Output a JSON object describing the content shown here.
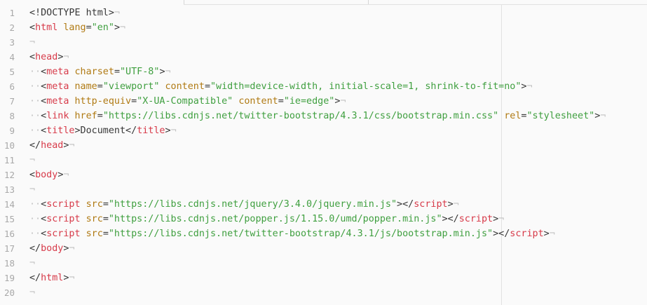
{
  "lines": [
    {
      "n": "1",
      "t": [
        [
          "p",
          "<!DOCTYPE html>"
        ]
      ]
    },
    {
      "n": "2",
      "t": [
        [
          "p",
          "<"
        ],
        [
          "tag",
          "html"
        ],
        [
          "p",
          " "
        ],
        [
          "attr",
          "lang"
        ],
        [
          "p",
          "="
        ],
        [
          "str",
          "\"en\""
        ],
        [
          "p",
          ">"
        ]
      ]
    },
    {
      "n": "3",
      "t": []
    },
    {
      "n": "4",
      "t": [
        [
          "p",
          "<"
        ],
        [
          "tag",
          "head"
        ],
        [
          "p",
          ">"
        ]
      ]
    },
    {
      "n": "5",
      "t": [
        [
          "ws",
          "··"
        ],
        [
          "p",
          "<"
        ],
        [
          "tag",
          "meta"
        ],
        [
          "p",
          " "
        ],
        [
          "attr",
          "charset"
        ],
        [
          "p",
          "="
        ],
        [
          "str",
          "\"UTF-8\""
        ],
        [
          "p",
          ">"
        ]
      ]
    },
    {
      "n": "6",
      "t": [
        [
          "ws",
          "··"
        ],
        [
          "p",
          "<"
        ],
        [
          "tag",
          "meta"
        ],
        [
          "p",
          " "
        ],
        [
          "attr",
          "name"
        ],
        [
          "p",
          "="
        ],
        [
          "str",
          "\"viewport\""
        ],
        [
          "p",
          " "
        ],
        [
          "attr",
          "content"
        ],
        [
          "p",
          "="
        ],
        [
          "str",
          "\"width=device-width, initial-scale=1, shrink-to-fit=no\""
        ],
        [
          "p",
          ">"
        ]
      ]
    },
    {
      "n": "7",
      "t": [
        [
          "ws",
          "··"
        ],
        [
          "p",
          "<"
        ],
        [
          "tag",
          "meta"
        ],
        [
          "p",
          " "
        ],
        [
          "attr",
          "http-equiv"
        ],
        [
          "p",
          "="
        ],
        [
          "str",
          "\"X-UA-Compatible\""
        ],
        [
          "p",
          " "
        ],
        [
          "attr",
          "content"
        ],
        [
          "p",
          "="
        ],
        [
          "str",
          "\"ie=edge\""
        ],
        [
          "p",
          ">"
        ]
      ]
    },
    {
      "n": "8",
      "t": [
        [
          "ws",
          "··"
        ],
        [
          "p",
          "<"
        ],
        [
          "tag",
          "link"
        ],
        [
          "p",
          " "
        ],
        [
          "attr",
          "href"
        ],
        [
          "p",
          "="
        ],
        [
          "str",
          "\"https://libs.cdnjs.net/twitter-bootstrap/4.3.1/css/bootstrap.min.css\""
        ],
        [
          "p",
          " "
        ],
        [
          "attr",
          "rel"
        ],
        [
          "p",
          "="
        ],
        [
          "str",
          "\"stylesheet\""
        ],
        [
          "p",
          ">"
        ]
      ]
    },
    {
      "n": "9",
      "t": [
        [
          "ws",
          "··"
        ],
        [
          "p",
          "<"
        ],
        [
          "tag",
          "title"
        ],
        [
          "p",
          ">Document</"
        ],
        [
          "tag",
          "title"
        ],
        [
          "p",
          ">"
        ]
      ]
    },
    {
      "n": "10",
      "t": [
        [
          "p",
          "</"
        ],
        [
          "tag",
          "head"
        ],
        [
          "p",
          ">"
        ]
      ]
    },
    {
      "n": "11",
      "t": []
    },
    {
      "n": "12",
      "t": [
        [
          "p",
          "<"
        ],
        [
          "tag",
          "body"
        ],
        [
          "p",
          ">"
        ]
      ]
    },
    {
      "n": "13",
      "t": []
    },
    {
      "n": "14",
      "t": [
        [
          "ws",
          "··"
        ],
        [
          "p",
          "<"
        ],
        [
          "tag",
          "script"
        ],
        [
          "p",
          " "
        ],
        [
          "attr",
          "src"
        ],
        [
          "p",
          "="
        ],
        [
          "str",
          "\"https://libs.cdnjs.net/jquery/3.4.0/jquery.min.js\""
        ],
        [
          "p",
          "></"
        ],
        [
          "tag",
          "script"
        ],
        [
          "p",
          ">"
        ]
      ]
    },
    {
      "n": "15",
      "t": [
        [
          "ws",
          "··"
        ],
        [
          "p",
          "<"
        ],
        [
          "tag",
          "script"
        ],
        [
          "p",
          " "
        ],
        [
          "attr",
          "src"
        ],
        [
          "p",
          "="
        ],
        [
          "str",
          "\"https://libs.cdnjs.net/popper.js/1.15.0/umd/popper.min.js\""
        ],
        [
          "p",
          "></"
        ],
        [
          "tag",
          "script"
        ],
        [
          "p",
          ">"
        ]
      ]
    },
    {
      "n": "16",
      "t": [
        [
          "ws",
          "··"
        ],
        [
          "p",
          "<"
        ],
        [
          "tag",
          "script"
        ],
        [
          "p",
          " "
        ],
        [
          "attr",
          "src"
        ],
        [
          "p",
          "="
        ],
        [
          "str",
          "\"https://libs.cdnjs.net/twitter-bootstrap/4.3.1/js/bootstrap.min.js\""
        ],
        [
          "p",
          "></"
        ],
        [
          "tag",
          "script"
        ],
        [
          "p",
          ">"
        ]
      ]
    },
    {
      "n": "17",
      "t": [
        [
          "p",
          "</"
        ],
        [
          "tag",
          "body"
        ],
        [
          "p",
          ">"
        ]
      ]
    },
    {
      "n": "18",
      "t": []
    },
    {
      "n": "19",
      "t": [
        [
          "p",
          "</"
        ],
        [
          "tag",
          "html"
        ],
        [
          "p",
          ">"
        ]
      ]
    },
    {
      "n": "20",
      "t": []
    }
  ],
  "eol_marker": "¬"
}
